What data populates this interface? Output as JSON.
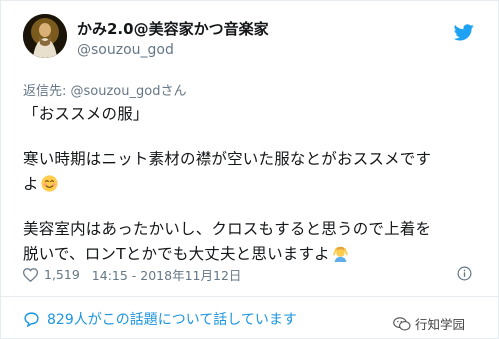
{
  "tweet": {
    "display_name": "かみ2.0@美容家かつ音楽家",
    "handle": "@souzou_god",
    "reply_prefix": "返信先: ",
    "reply_handle": "@souzou_god",
    "reply_suffix": "さん",
    "line1": "「おススメの服」",
    "para2_line1": "寒い時期はニット素材の襟が空いた服なとがおススメです",
    "para2_line2": "よ",
    "para3_line1": "美容室内はあったかいし、クロスもすると思うので上着を",
    "para3_line2": "脱いで、ロンTとかでも大丈夫と思いますよ",
    "emoji_smile": "smiling-face-emoji",
    "emoji_person": "person-gesturing-ok-emoji"
  },
  "meta": {
    "likes": "1,519",
    "timestamp": "14:15 - 2018年11月12日"
  },
  "footer": {
    "talk_count_text": "829人がこの話題について話しています",
    "watermark": "行知学园"
  },
  "colors": {
    "link_blue": "#1b95e0",
    "secondary": "#657786",
    "divider": "#e6ecf0",
    "twitter_blue": "#1da1f2"
  },
  "icons": [
    "twitter-bird-icon",
    "heart-icon",
    "info-icon",
    "comment-icon",
    "wechat-icon"
  ]
}
